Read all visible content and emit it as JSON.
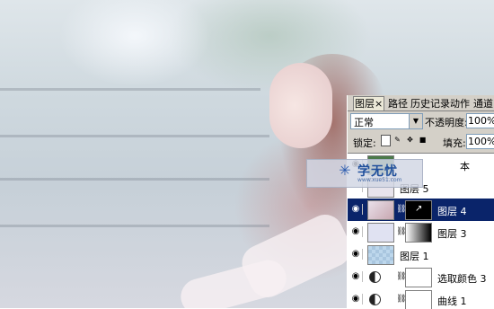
{
  "panel": {
    "tabs": [
      "图层",
      "路径",
      "历史记录",
      "动作",
      "通道"
    ],
    "tab_close": "×",
    "blend_mode": "正常",
    "opacity_label": "不透明度:",
    "opacity_value": "100%",
    "lock_label": "锁定:",
    "fill_label": "填充:",
    "fill_value": "100%",
    "layers": [
      {
        "name": "本",
        "visible": true
      },
      {
        "name": "图层 5",
        "visible": false
      },
      {
        "name": "图层 4",
        "visible": true,
        "selected": true
      },
      {
        "name": "图层 3",
        "visible": true
      },
      {
        "name": "图层 1",
        "visible": true
      },
      {
        "name": "选取颜色 3",
        "visible": true
      },
      {
        "name": "曲线 1",
        "visible": true
      }
    ]
  },
  "watermark": {
    "title": "学无忧",
    "url": "www.xue51.com"
  },
  "colors": {
    "selection": "#0a246a",
    "panel_bg": "#d4d0c8"
  }
}
